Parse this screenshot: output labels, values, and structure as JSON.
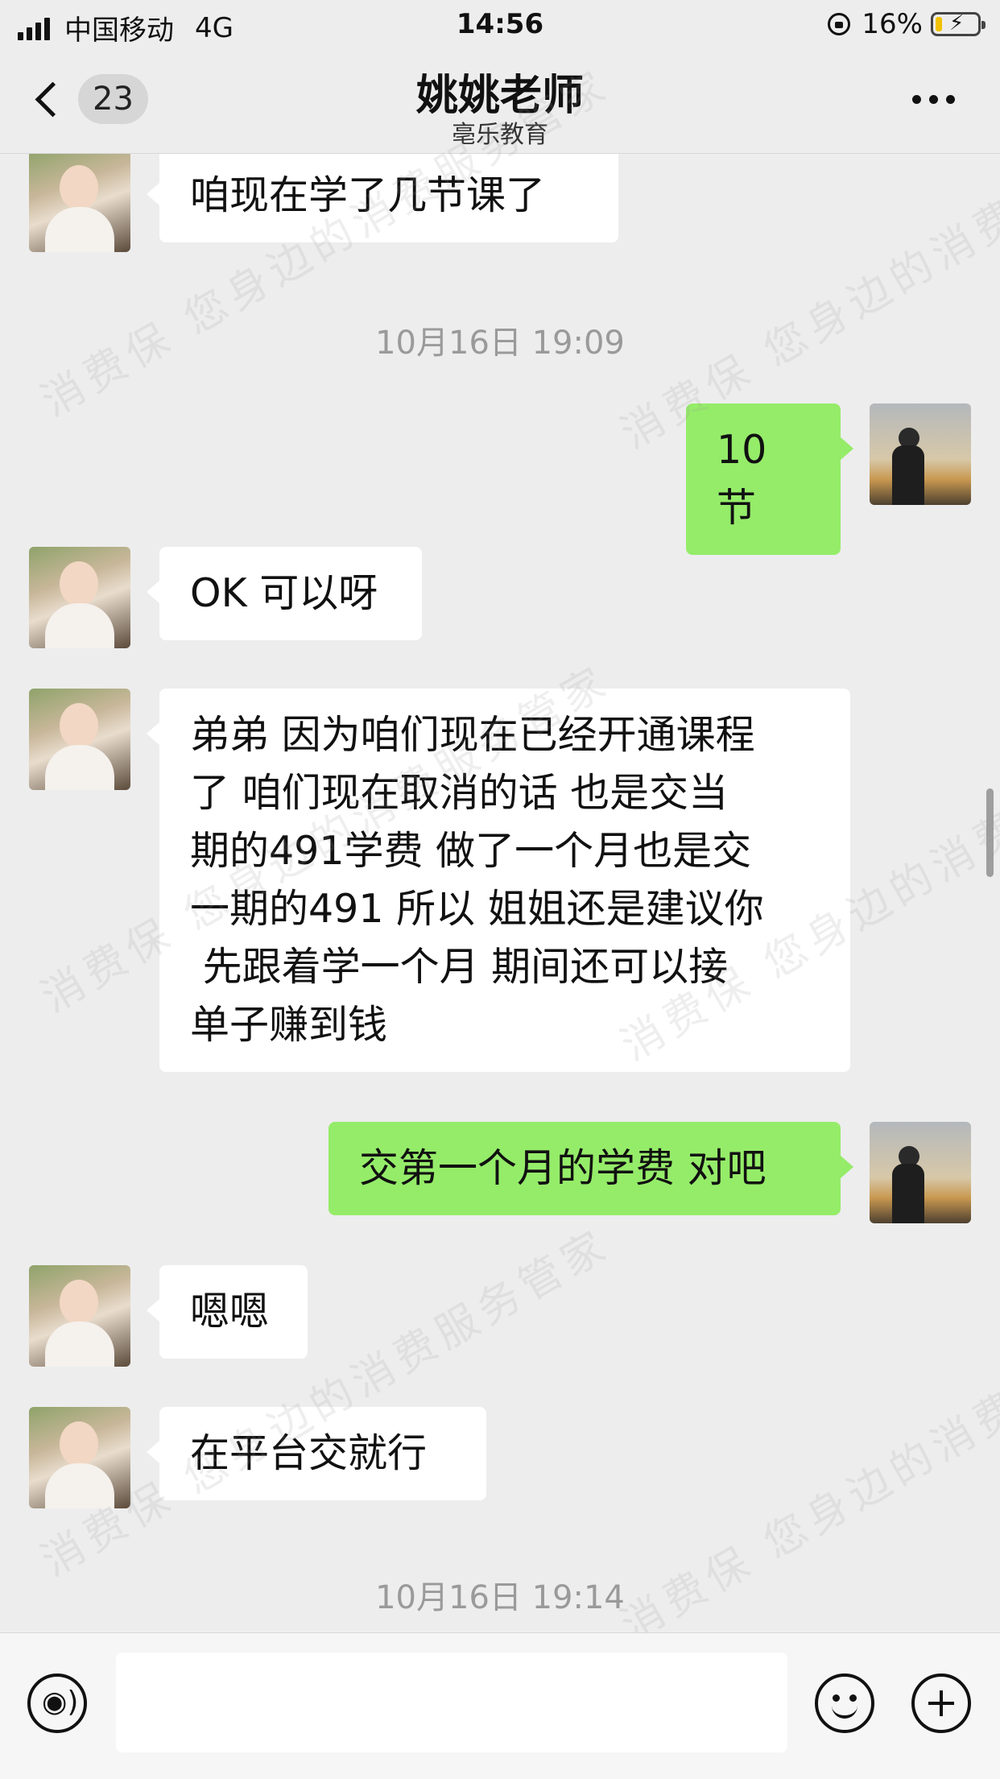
{
  "status_bar": {
    "carrier": "中国移动",
    "network": "4G",
    "time": "14:56",
    "battery": "16%",
    "battery_level": 0.16
  },
  "nav": {
    "unread_count": "23",
    "title": "姚姚老师",
    "subtitle": "亳乐教育"
  },
  "messages": [
    {
      "side": "in",
      "text": "咱现在学了几节课了"
    },
    {
      "type": "time",
      "text": "10月16日 19:09"
    },
    {
      "side": "out",
      "text": "10 节"
    },
    {
      "side": "in",
      "text": "OK 可以呀"
    },
    {
      "side": "in",
      "text": "弟弟 因为咱们现在已经开通课程\n了 咱们现在取消的话 也是交当\n期的491学费 做了一个月也是交\n一期的491 所以 姐姐还是建议你\n 先跟着学一个月 期间还可以接\n单子赚到钱"
    },
    {
      "side": "out",
      "text": "交第一个月的学费 对吧"
    },
    {
      "side": "in",
      "text": "嗯嗯"
    },
    {
      "side": "in",
      "text": "在平台交就行"
    },
    {
      "type": "time",
      "text": "10月16日 19:14"
    }
  ],
  "input": {
    "placeholder": ""
  },
  "watermark": "消费保 您身边的消费服务管家",
  "colors": {
    "background": "#ededed",
    "outgoing_bubble": "#95ec69",
    "incoming_bubble": "#ffffff"
  }
}
